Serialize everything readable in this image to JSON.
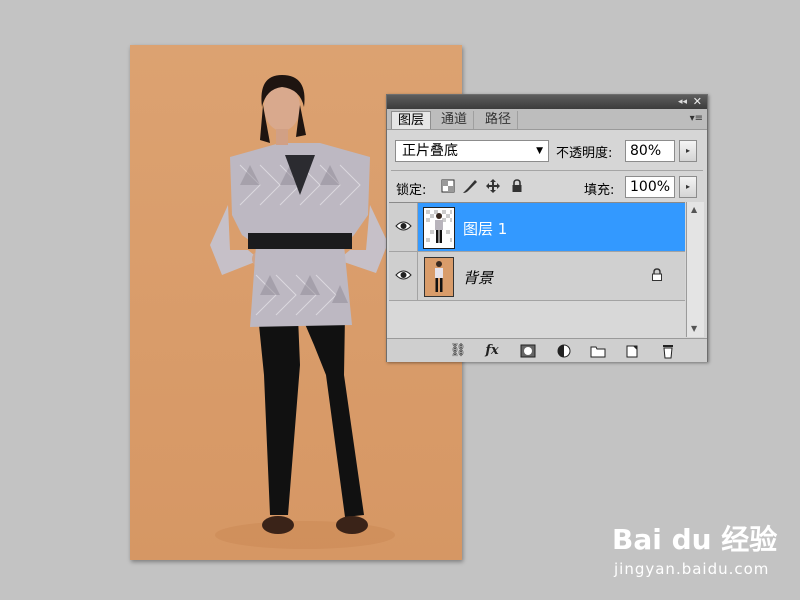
{
  "panel": {
    "tabs": [
      {
        "label": "图层",
        "active": true
      },
      {
        "label": "通道",
        "active": false
      },
      {
        "label": "路径",
        "active": false
      }
    ],
    "blend_mode": "正片叠底",
    "opacity_label": "不透明度:",
    "opacity_value": "80%",
    "lock_label": "锁定:",
    "fill_label": "填充:",
    "fill_value": "100%",
    "layers": [
      {
        "name": "图层 1",
        "selected": true,
        "visible": true
      },
      {
        "name": "背景",
        "selected": false,
        "visible": true,
        "locked": true
      }
    ],
    "footer_icons": [
      "link-icon",
      "fx-icon",
      "mask-icon",
      "adjustment-icon",
      "folder-icon",
      "new-layer-icon",
      "trash-icon"
    ],
    "fx_label": "fx"
  },
  "watermark": {
    "brand": "Bai du 经验",
    "url": "jingyan.baidu.com"
  },
  "colors": {
    "selection": "#3399ff",
    "canvas_bg": "#c3c3c3",
    "photo_bg": "#d99c6a"
  }
}
